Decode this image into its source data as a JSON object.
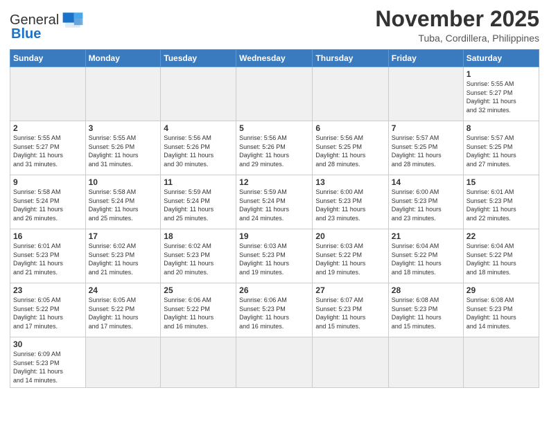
{
  "logo": {
    "text_general": "General",
    "text_blue": "Blue"
  },
  "header": {
    "month_year": "November 2025",
    "location": "Tuba, Cordillera, Philippines"
  },
  "weekdays": [
    "Sunday",
    "Monday",
    "Tuesday",
    "Wednesday",
    "Thursday",
    "Friday",
    "Saturday"
  ],
  "weeks": [
    [
      {
        "day": "",
        "info": ""
      },
      {
        "day": "",
        "info": ""
      },
      {
        "day": "",
        "info": ""
      },
      {
        "day": "",
        "info": ""
      },
      {
        "day": "",
        "info": ""
      },
      {
        "day": "",
        "info": ""
      },
      {
        "day": "1",
        "info": "Sunrise: 5:55 AM\nSunset: 5:27 PM\nDaylight: 11 hours\nand 32 minutes."
      }
    ],
    [
      {
        "day": "2",
        "info": "Sunrise: 5:55 AM\nSunset: 5:27 PM\nDaylight: 11 hours\nand 31 minutes."
      },
      {
        "day": "3",
        "info": "Sunrise: 5:55 AM\nSunset: 5:26 PM\nDaylight: 11 hours\nand 31 minutes."
      },
      {
        "day": "4",
        "info": "Sunrise: 5:56 AM\nSunset: 5:26 PM\nDaylight: 11 hours\nand 30 minutes."
      },
      {
        "day": "5",
        "info": "Sunrise: 5:56 AM\nSunset: 5:26 PM\nDaylight: 11 hours\nand 29 minutes."
      },
      {
        "day": "6",
        "info": "Sunrise: 5:56 AM\nSunset: 5:25 PM\nDaylight: 11 hours\nand 28 minutes."
      },
      {
        "day": "7",
        "info": "Sunrise: 5:57 AM\nSunset: 5:25 PM\nDaylight: 11 hours\nand 28 minutes."
      },
      {
        "day": "8",
        "info": "Sunrise: 5:57 AM\nSunset: 5:25 PM\nDaylight: 11 hours\nand 27 minutes."
      }
    ],
    [
      {
        "day": "9",
        "info": "Sunrise: 5:58 AM\nSunset: 5:24 PM\nDaylight: 11 hours\nand 26 minutes."
      },
      {
        "day": "10",
        "info": "Sunrise: 5:58 AM\nSunset: 5:24 PM\nDaylight: 11 hours\nand 25 minutes."
      },
      {
        "day": "11",
        "info": "Sunrise: 5:59 AM\nSunset: 5:24 PM\nDaylight: 11 hours\nand 25 minutes."
      },
      {
        "day": "12",
        "info": "Sunrise: 5:59 AM\nSunset: 5:24 PM\nDaylight: 11 hours\nand 24 minutes."
      },
      {
        "day": "13",
        "info": "Sunrise: 6:00 AM\nSunset: 5:23 PM\nDaylight: 11 hours\nand 23 minutes."
      },
      {
        "day": "14",
        "info": "Sunrise: 6:00 AM\nSunset: 5:23 PM\nDaylight: 11 hours\nand 23 minutes."
      },
      {
        "day": "15",
        "info": "Sunrise: 6:01 AM\nSunset: 5:23 PM\nDaylight: 11 hours\nand 22 minutes."
      }
    ],
    [
      {
        "day": "16",
        "info": "Sunrise: 6:01 AM\nSunset: 5:23 PM\nDaylight: 11 hours\nand 21 minutes."
      },
      {
        "day": "17",
        "info": "Sunrise: 6:02 AM\nSunset: 5:23 PM\nDaylight: 11 hours\nand 21 minutes."
      },
      {
        "day": "18",
        "info": "Sunrise: 6:02 AM\nSunset: 5:23 PM\nDaylight: 11 hours\nand 20 minutes."
      },
      {
        "day": "19",
        "info": "Sunrise: 6:03 AM\nSunset: 5:23 PM\nDaylight: 11 hours\nand 19 minutes."
      },
      {
        "day": "20",
        "info": "Sunrise: 6:03 AM\nSunset: 5:22 PM\nDaylight: 11 hours\nand 19 minutes."
      },
      {
        "day": "21",
        "info": "Sunrise: 6:04 AM\nSunset: 5:22 PM\nDaylight: 11 hours\nand 18 minutes."
      },
      {
        "day": "22",
        "info": "Sunrise: 6:04 AM\nSunset: 5:22 PM\nDaylight: 11 hours\nand 18 minutes."
      }
    ],
    [
      {
        "day": "23",
        "info": "Sunrise: 6:05 AM\nSunset: 5:22 PM\nDaylight: 11 hours\nand 17 minutes."
      },
      {
        "day": "24",
        "info": "Sunrise: 6:05 AM\nSunset: 5:22 PM\nDaylight: 11 hours\nand 17 minutes."
      },
      {
        "day": "25",
        "info": "Sunrise: 6:06 AM\nSunset: 5:22 PM\nDaylight: 11 hours\nand 16 minutes."
      },
      {
        "day": "26",
        "info": "Sunrise: 6:06 AM\nSunset: 5:23 PM\nDaylight: 11 hours\nand 16 minutes."
      },
      {
        "day": "27",
        "info": "Sunrise: 6:07 AM\nSunset: 5:23 PM\nDaylight: 11 hours\nand 15 minutes."
      },
      {
        "day": "28",
        "info": "Sunrise: 6:08 AM\nSunset: 5:23 PM\nDaylight: 11 hours\nand 15 minutes."
      },
      {
        "day": "29",
        "info": "Sunrise: 6:08 AM\nSunset: 5:23 PM\nDaylight: 11 hours\nand 14 minutes."
      }
    ],
    [
      {
        "day": "30",
        "info": "Sunrise: 6:09 AM\nSunset: 5:23 PM\nDaylight: 11 hours\nand 14 minutes."
      },
      {
        "day": "",
        "info": ""
      },
      {
        "day": "",
        "info": ""
      },
      {
        "day": "",
        "info": ""
      },
      {
        "day": "",
        "info": ""
      },
      {
        "day": "",
        "info": ""
      },
      {
        "day": "",
        "info": ""
      }
    ]
  ]
}
